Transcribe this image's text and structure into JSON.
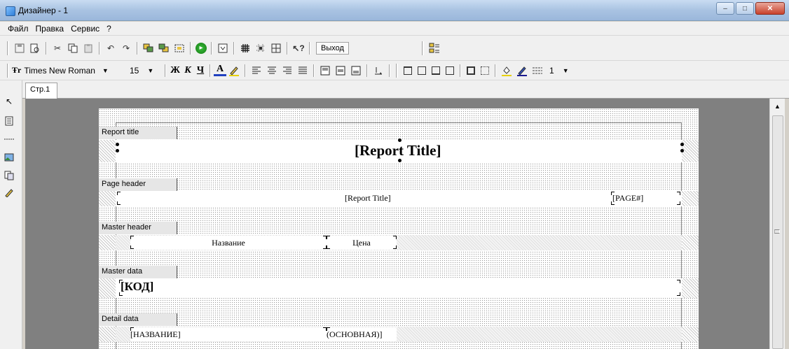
{
  "window": {
    "title": "Дизайнер - 1",
    "minimize_glyph": "–",
    "maximize_glyph": "□",
    "close_glyph": "✕"
  },
  "menu": [
    "Файл",
    "Правка",
    "Сервис",
    "?"
  ],
  "toolbar": {
    "exit_label": "Выход",
    "font_name": "Times New Roman",
    "font_size": "15",
    "bold": "Ж",
    "italic": "К",
    "underline": "Ч",
    "font_color_glyph": "A",
    "line_width": "1"
  },
  "tabs": [
    "Стр.1"
  ],
  "bands": {
    "report_title": {
      "label": "Report title",
      "field": "[Report Title]"
    },
    "page_header": {
      "label": "Page header",
      "title_field": "[Report Title]",
      "page_field": "[PAGE#]"
    },
    "master_header": {
      "label": "Master header",
      "name_field": "Название",
      "price_field": "Цена"
    },
    "master_data": {
      "label": "Master data",
      "code_field": "[КОД]"
    },
    "detail_data": {
      "label": "Detail data",
      "name_field": "[НАЗВАНИЕ]",
      "main_field": "(ОСНОВНАЯ)]"
    }
  }
}
